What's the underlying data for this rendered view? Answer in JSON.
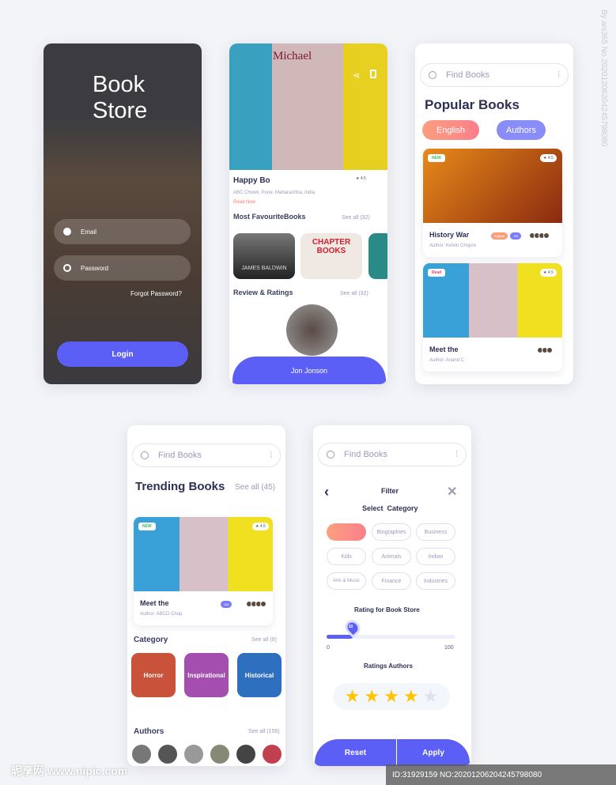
{
  "login": {
    "title_line1": "Book",
    "title_line2": "Store",
    "email_placeholder": "Email",
    "password_placeholder": "Password",
    "forgot": "Forgot Password?",
    "login_button": "Login"
  },
  "detail": {
    "book_title": "Happy Bo",
    "rating": "4.5",
    "address": "ABC Chowk, Pune, Maharashtra, India",
    "read_now": "Read Now",
    "fav_title": "Most FavouriteBooks",
    "fav_see_all": "See all (32)",
    "fav_books": [
      "JAMES BALDWIN",
      "CHAPTER BOOKS"
    ],
    "review_title": "Review & Ratings",
    "review_see_all": "See all (32)",
    "user_name": "Jon Jonson",
    "icons": [
      "share-icon",
      "bookmark-icon"
    ]
  },
  "popular": {
    "search_placeholder": "Find Books",
    "title": "Popular Books",
    "tabs": [
      {
        "label": "English",
        "active": true
      },
      {
        "label": "Authors",
        "active": false
      }
    ],
    "books": [
      {
        "badge": "NEW",
        "rating": "4.5",
        "title": "History War",
        "author": "Author: Kelvin Chopra",
        "tags": [
          "English",
          "10k"
        ]
      },
      {
        "badge": "Read",
        "rating": "4.5",
        "title": "Meet the",
        "author": "Author: Anand C"
      }
    ]
  },
  "trending": {
    "search_placeholder": "Find Books",
    "title": "Trending Books",
    "see_all": "See all (45)",
    "book": {
      "badge": "NEW",
      "rating": "4.5",
      "title": "Meet the",
      "author": "Author: ABCD Chop",
      "tag": "10k"
    },
    "category_title": "Category",
    "category_see_all": "See all (9)",
    "categories": [
      {
        "label": "Horror",
        "color": "#c9523a"
      },
      {
        "label": "Inspirational",
        "color": "#a44fb0"
      },
      {
        "label": "Historical",
        "color": "#2f6fc0"
      }
    ],
    "authors_title": "Authors",
    "authors_see_all": "See all (156)"
  },
  "filter": {
    "search_placeholder": "Find Books",
    "title": "Filter",
    "select_category": "Select  Category",
    "chips": [
      "",
      "Biographies",
      "Business",
      "Kids",
      "Animals",
      "Indian",
      "Arts & Music",
      "Finance",
      "Industries"
    ],
    "rating_title": "Rating for Book Store",
    "slider_value": "10",
    "slider_min": "0",
    "slider_max": "100",
    "ratings_authors": "Ratings Authors",
    "stars": 4,
    "stars_max": 5,
    "reset": "Reset",
    "apply": "Apply"
  },
  "colors": {
    "accent": "#5b5ff5",
    "coral": "#fb8f7e",
    "dark": "#2d2f55",
    "star": "#ffc400"
  },
  "watermark": {
    "side": "By:ais365 No.20201206204245798080",
    "bottom": "ID:31929159 NO:20201206204245798080",
    "logo": "昵享网 www.nipic.com"
  }
}
